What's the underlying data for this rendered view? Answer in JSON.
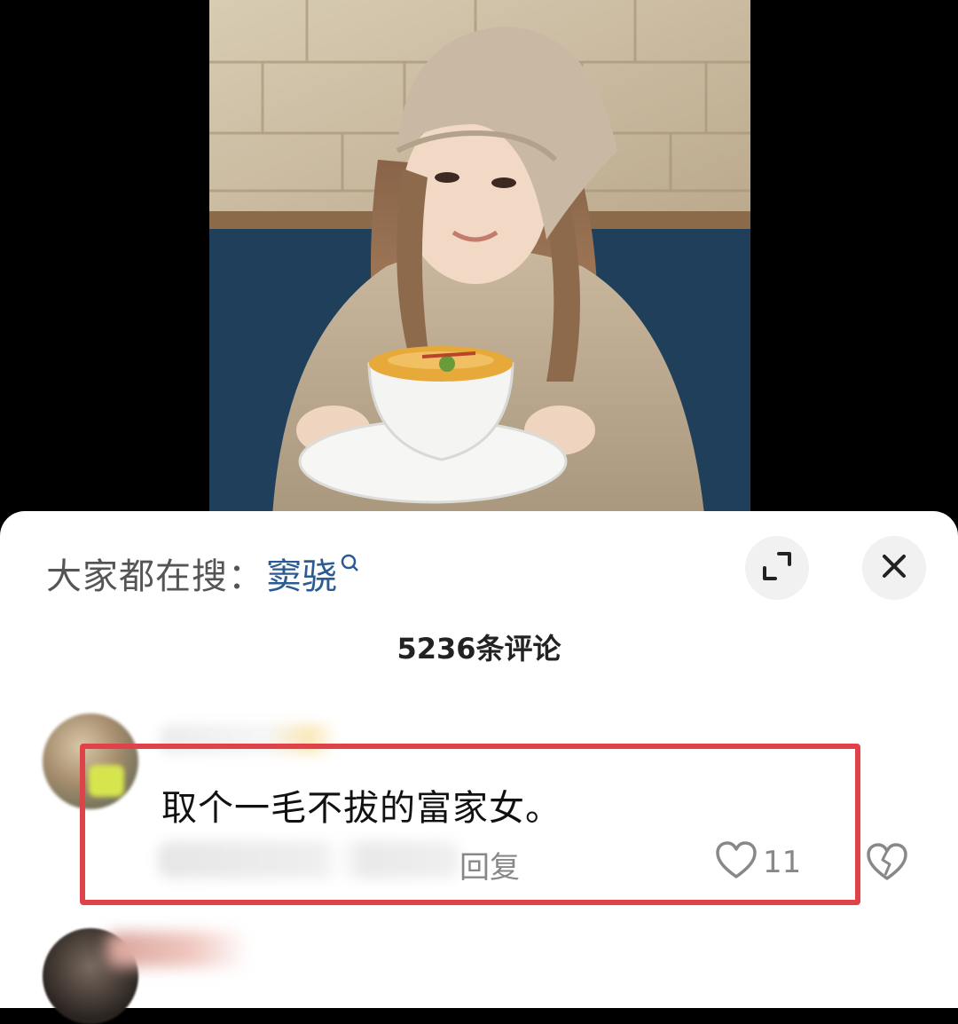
{
  "photo": {
    "description_icon": "photo-image"
  },
  "sheet": {
    "search_prefix": "大家都在搜：",
    "search_term": "窦骁",
    "comment_count": "5236条评论"
  },
  "comment": {
    "text": "取个一毛不拔的富家女。",
    "reply_label": "回复",
    "like_count": "11"
  },
  "colors": {
    "search_term": "#2a5b92",
    "highlight_border": "#e0424a",
    "sheet_background": "#ffffff",
    "backdrop": "#000000"
  },
  "icons": {
    "search": "search-icon",
    "expand": "expand-icon",
    "close": "close-icon",
    "like": "heart-icon",
    "dislike": "broken-heart-icon"
  }
}
